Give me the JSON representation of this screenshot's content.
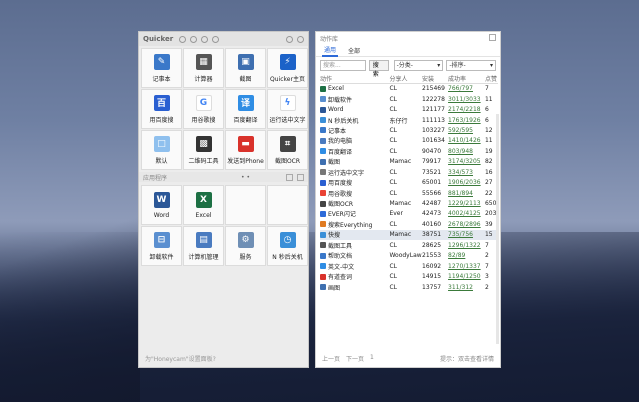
{
  "quicker": {
    "title": "Quicker",
    "tiles1": [
      {
        "label": "记事本",
        "icon": "notepad-icon",
        "color": "#3a78c9",
        "glyph": "✎"
      },
      {
        "label": "计算器",
        "icon": "calculator-icon",
        "color": "#555555",
        "glyph": "▦"
      },
      {
        "label": "截图",
        "icon": "screenshot-icon",
        "color": "#3e6fb0",
        "glyph": "▣"
      },
      {
        "label": "Quicker主页",
        "icon": "quicker-home-icon",
        "color": "#1c62c8",
        "glyph": "⚡"
      },
      {
        "label": "用百度搜",
        "icon": "baidu-icon",
        "color": "#2a5fd1",
        "glyph": "百"
      },
      {
        "label": "用谷歌搜",
        "icon": "google-icon",
        "color": "#ffffff",
        "glyph": "G"
      },
      {
        "label": "百度翻译",
        "icon": "translate-icon",
        "color": "#2f8de4",
        "glyph": "译"
      },
      {
        "label": "运行选中文字",
        "icon": "run-icon",
        "color": "#ffffff",
        "glyph": "ϟ"
      },
      {
        "label": "默认",
        "icon": "default-icon",
        "color": "#8fc0ee",
        "glyph": "□"
      },
      {
        "label": "二维码工具",
        "icon": "qrcode-icon",
        "color": "#333333",
        "glyph": "▩"
      },
      {
        "label": "发送到Phone",
        "icon": "send-phone-icon",
        "color": "#d9322b",
        "glyph": "▬"
      },
      {
        "label": "截图OCR",
        "icon": "ocr-icon",
        "color": "#444444",
        "glyph": "⌗"
      }
    ],
    "section_title": "应用程序",
    "pager": "• •",
    "tiles2": [
      {
        "label": "Word",
        "icon": "word-icon",
        "color": "#2b5797",
        "glyph": "W"
      },
      {
        "label": "Excel",
        "icon": "excel-icon",
        "color": "#1d7044",
        "glyph": "X"
      },
      {
        "label": "",
        "icon": "",
        "color": "",
        "glyph": ""
      },
      {
        "label": "",
        "icon": "",
        "color": "",
        "glyph": ""
      },
      {
        "label": "卸载软件",
        "icon": "uninstall-icon",
        "color": "#5a8fd0",
        "glyph": "⊟"
      },
      {
        "label": "计算机管理",
        "icon": "computer-manage-icon",
        "color": "#4a7bc0",
        "glyph": "▤"
      },
      {
        "label": "服务",
        "icon": "service-icon",
        "color": "#6f8fb5",
        "glyph": "⚙"
      },
      {
        "label": "N 秒后关机",
        "icon": "shutdown-timer-icon",
        "color": "#3a8fd8",
        "glyph": "◷"
      }
    ],
    "footer": "为\"Honeycam\"设置面板?"
  },
  "library": {
    "title": "动作库",
    "tabs": [
      "通用",
      "全部"
    ],
    "search_placeholder": "搜索...",
    "search_button": "搜索",
    "category": "-分类-",
    "sort": "-排序-",
    "columns": [
      "动作",
      "分享人",
      "安装",
      "成功率",
      "点赞"
    ],
    "rows": [
      {
        "name": "Excel",
        "sharer": "CL",
        "installs": "215469",
        "rate": "766/797",
        "likes": "7",
        "color": "#1d7044"
      },
      {
        "name": "卸载软件",
        "sharer": "CL",
        "installs": "122278",
        "rate": "3011/3033",
        "likes": "11",
        "color": "#5a8fd0"
      },
      {
        "name": "Word",
        "sharer": "CL",
        "installs": "121177",
        "rate": "2174/2218",
        "likes": "6",
        "color": "#2b5797"
      },
      {
        "name": "N 秒后关机",
        "sharer": "东仔行",
        "installs": "111113",
        "rate": "1763/1926",
        "likes": "6",
        "color": "#3a8fd8"
      },
      {
        "name": "记事本",
        "sharer": "CL",
        "installs": "103227",
        "rate": "592/595",
        "likes": "12",
        "color": "#3a78c9"
      },
      {
        "name": "我的电脑",
        "sharer": "CL",
        "installs": "101634",
        "rate": "1410/1426",
        "likes": "11",
        "color": "#4a7bc0"
      },
      {
        "name": "百度翻译",
        "sharer": "CL",
        "installs": "90470",
        "rate": "803/948",
        "likes": "19",
        "color": "#2f8de4"
      },
      {
        "name": "截图",
        "sharer": "Mamac",
        "installs": "79917",
        "rate": "3174/3205",
        "likes": "82",
        "color": "#3e6fb0"
      },
      {
        "name": "运行选中文字",
        "sharer": "CL",
        "installs": "73521",
        "rate": "334/573",
        "likes": "16",
        "color": "#777777"
      },
      {
        "name": "用百度搜",
        "sharer": "CL",
        "installs": "65001",
        "rate": "1906/2036",
        "likes": "27",
        "color": "#2a5fd1"
      },
      {
        "name": "用谷歌搜",
        "sharer": "CL",
        "installs": "55566",
        "rate": "881/894",
        "likes": "22",
        "color": "#ea4335"
      },
      {
        "name": "截图OCR",
        "sharer": "Mamac",
        "installs": "42487",
        "rate": "1229/2113",
        "likes": "650",
        "color": "#444444"
      },
      {
        "name": "EVER闪记",
        "sharer": "Ever",
        "installs": "42473",
        "rate": "4002/4125",
        "likes": "203",
        "color": "#2d6ad8"
      },
      {
        "name": "搜索Everything",
        "sharer": "CL",
        "installs": "40160",
        "rate": "2678/2896",
        "likes": "39",
        "color": "#e07b22"
      },
      {
        "name": "快搜",
        "sharer": "Mamac",
        "installs": "38751",
        "rate": "735/756",
        "likes": "15",
        "color": "#3a8fd8"
      },
      {
        "name": "截图工具",
        "sharer": "CL",
        "installs": "28625",
        "rate": "1296/1322",
        "likes": "7",
        "color": "#555555"
      },
      {
        "name": "帮助文档",
        "sharer": "WoodyLaw",
        "installs": "21553",
        "rate": "82/89",
        "likes": "2",
        "color": "#3a78c9"
      },
      {
        "name": "英文-中文",
        "sharer": "CL",
        "installs": "16092",
        "rate": "1270/1337",
        "likes": "7",
        "color": "#2f8de4"
      },
      {
        "name": "有道查词",
        "sharer": "CL",
        "installs": "14915",
        "rate": "1194/1250",
        "likes": "3",
        "color": "#d9322b"
      },
      {
        "name": "画图",
        "sharer": "CL",
        "installs": "13757",
        "rate": "311/312",
        "likes": "2",
        "color": "#3e6fb0"
      }
    ],
    "highlighted_row": 14,
    "prev": "上一页",
    "next": "下一页",
    "page": "1",
    "status": "提示：双击查看详情"
  }
}
